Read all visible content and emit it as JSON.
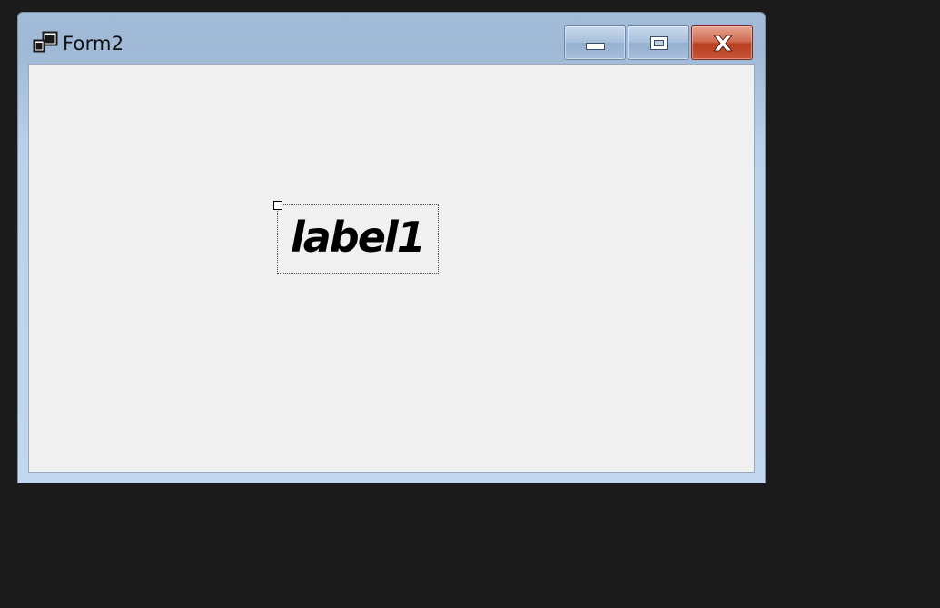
{
  "window": {
    "title": "Form2",
    "icon": "form-window-icon",
    "controls": {
      "minimize_icon": "minimize-icon",
      "maximize_icon": "restore-icon",
      "close_icon": "close-icon"
    },
    "colors": {
      "frame": "#a2bcd9",
      "client_background": "#f0f0f0",
      "close_button": "#c9543a"
    }
  },
  "form": {
    "label": {
      "text": "label1",
      "color": "#000000"
    }
  },
  "desktop": {
    "background": "#1b1b1b"
  }
}
